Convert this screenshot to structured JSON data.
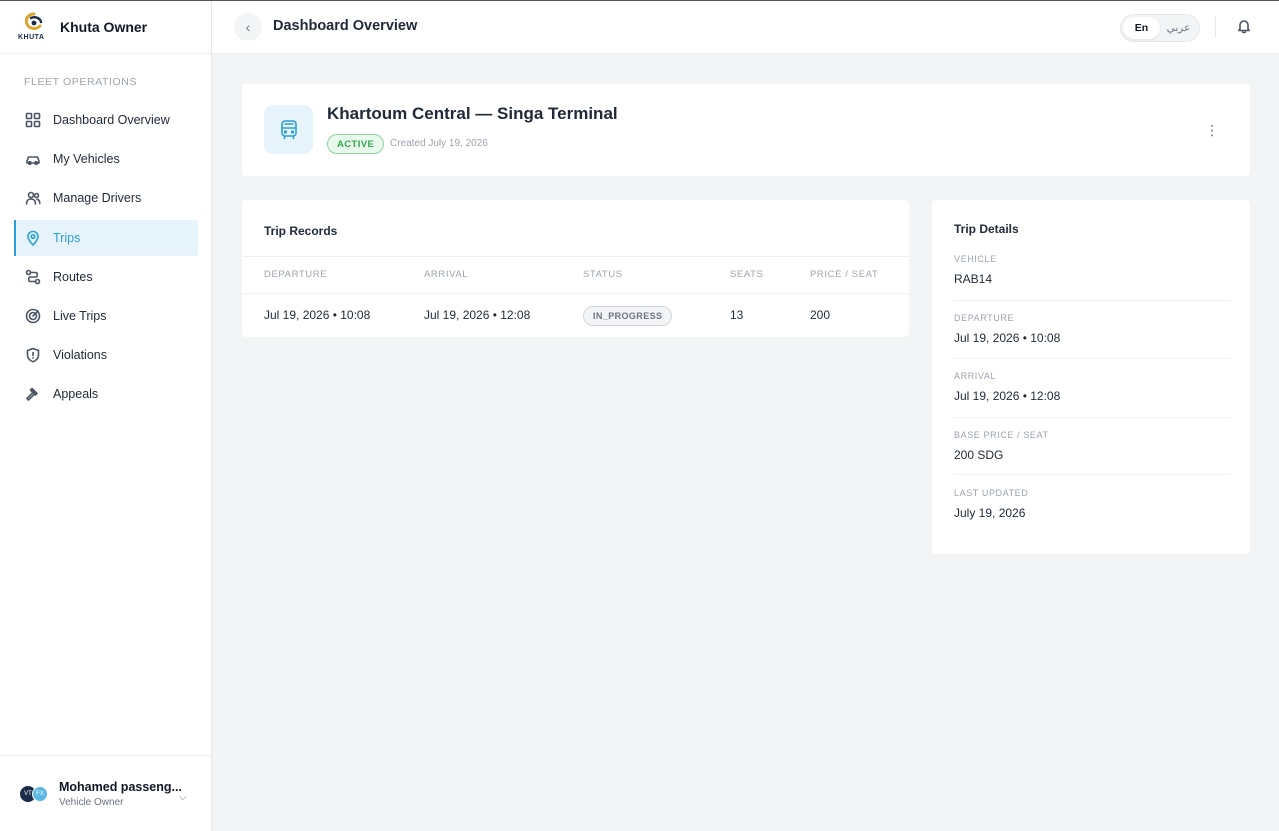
{
  "app": {
    "brand_name": "Khuta Owner",
    "logo_wordmark": "KHUTA"
  },
  "sidebar": {
    "section_label": "FLEET OPERATIONS",
    "items": [
      {
        "label": "Dashboard Overview",
        "icon": "grid-icon",
        "active": false
      },
      {
        "label": "My Vehicles",
        "icon": "car-icon",
        "active": false
      },
      {
        "label": "Manage Drivers",
        "icon": "users-icon",
        "active": false
      },
      {
        "label": "Trips",
        "icon": "map-pin-icon",
        "active": true
      },
      {
        "label": "Routes",
        "icon": "route-icon",
        "active": false
      },
      {
        "label": "Live Trips",
        "icon": "radar-icon",
        "active": false
      },
      {
        "label": "Violations",
        "icon": "shield-alert-icon",
        "active": false
      },
      {
        "label": "Appeals",
        "icon": "gavel-icon",
        "active": false
      }
    ],
    "user": {
      "name": "Mohamed passeng...",
      "role": "Vehicle Owner",
      "avatar_left": "VT",
      "avatar_right": "FX"
    }
  },
  "header": {
    "title": "Dashboard Overview",
    "lang_en": "En",
    "lang_ar": "عربي",
    "active_lang": "En"
  },
  "route": {
    "title": "Khartoum Central — Singa Terminal",
    "status": "ACTIVE",
    "created": "Created July 19, 2026"
  },
  "trip_records": {
    "title": "Trip Records",
    "columns": [
      "DEPARTURE",
      "ARRIVAL",
      "STATUS",
      "SEATS",
      "PRICE / SEAT"
    ],
    "rows": [
      {
        "departure": "Jul 19, 2026 • 10:08",
        "arrival": "Jul 19, 2026 • 12:08",
        "status": "IN_PROGRESS",
        "seats": "13",
        "price": "200"
      }
    ]
  },
  "trip_details": {
    "title": "Trip Details",
    "fields": [
      {
        "label": "VEHICLE",
        "value": "RAB14"
      },
      {
        "label": "DEPARTURE",
        "value": "Jul 19, 2026 • 10:08"
      },
      {
        "label": "ARRIVAL",
        "value": "Jul 19, 2026 • 12:08"
      },
      {
        "label": "BASE PRICE / SEAT",
        "value": "200 SDG"
      },
      {
        "label": "LAST UPDATED",
        "value": "July 19, 2026"
      }
    ]
  },
  "colors": {
    "accent": "#2b9fd6",
    "active_badge": "#2fa84a",
    "background": "#f3f4f6"
  }
}
